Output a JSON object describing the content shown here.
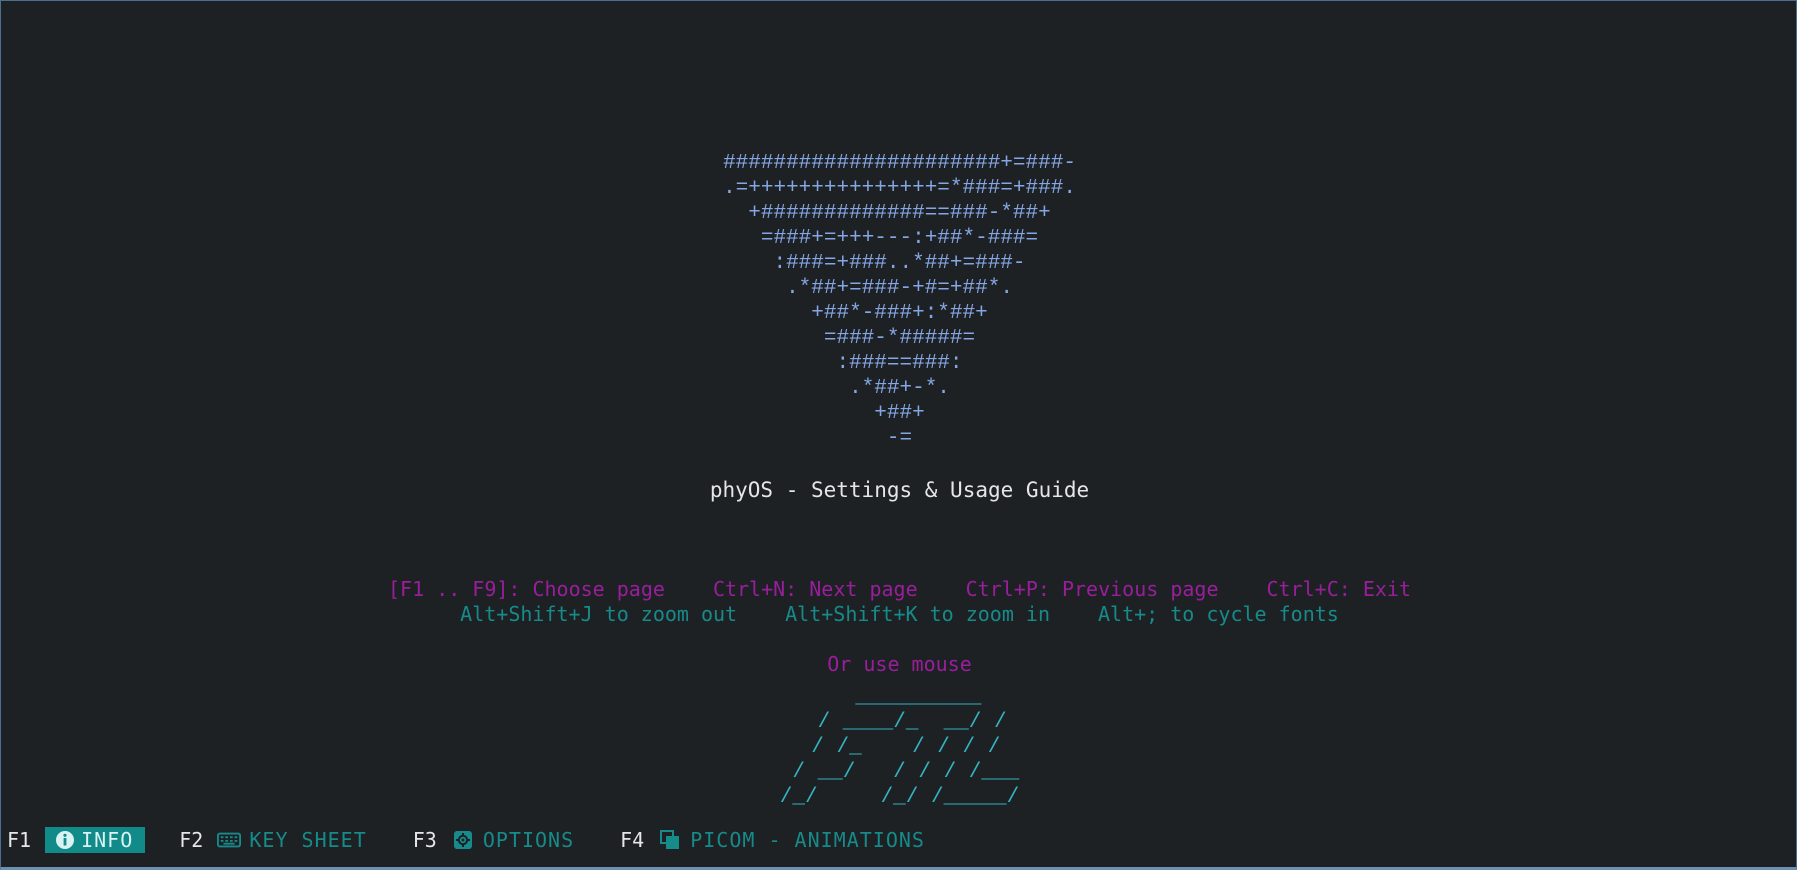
{
  "logo_ascii": "######################+=###-\n.=+++++++++++++++=*###=+###.\n+#############==###-*##+\n=###+=+++---:+##*-###=\n:###=+###..*##+=###-\n.*##+=###-+#=+##*.\n+##*-###+:*##+\n=###-*#####=\n:###==###:\n.*##+-*.\n+##+\n-=",
  "title": "phyOS - Settings & Usage Guide",
  "navigation_help": {
    "choose_page": "[F1 .. F9]: Choose page",
    "next_page": "Ctrl+N: Next page",
    "previous_page": "Ctrl+P: Previous page",
    "exit": "Ctrl+C: Exit",
    "mouse": "Or use mouse"
  },
  "zoom_help": {
    "zoom_out": "Alt+Shift+J to zoom out",
    "zoom_in": "Alt+Shift+K to zoom in",
    "cycle_fonts": "Alt+; to cycle fonts"
  },
  "ft_ascii": "   __________\n  / ____/_  __/ /\n / /_    / / / /\n / __/   / / / /___\n/_/     /_/ /_____/",
  "tabs": [
    {
      "key": "F1",
      "label": "INFO",
      "icon": "info-icon",
      "active": true
    },
    {
      "key": "F2",
      "label": "KEY SHEET",
      "icon": "keyboard-icon",
      "active": false
    },
    {
      "key": "F3",
      "label": "OPTIONS",
      "icon": "gear-icon",
      "active": false
    },
    {
      "key": "F4",
      "label": "PICOM - ANIMATIONS",
      "icon": "windows-icon",
      "active": false
    }
  ],
  "colors": {
    "background": "#1d2124",
    "logo": "#86a7e6",
    "title": "#e6e6e6",
    "nav_help": "#9a1e9c",
    "zoom_help": "#178a8a",
    "ft_logo": "#34b3c0",
    "active_tab_bg": "#118a8a"
  }
}
